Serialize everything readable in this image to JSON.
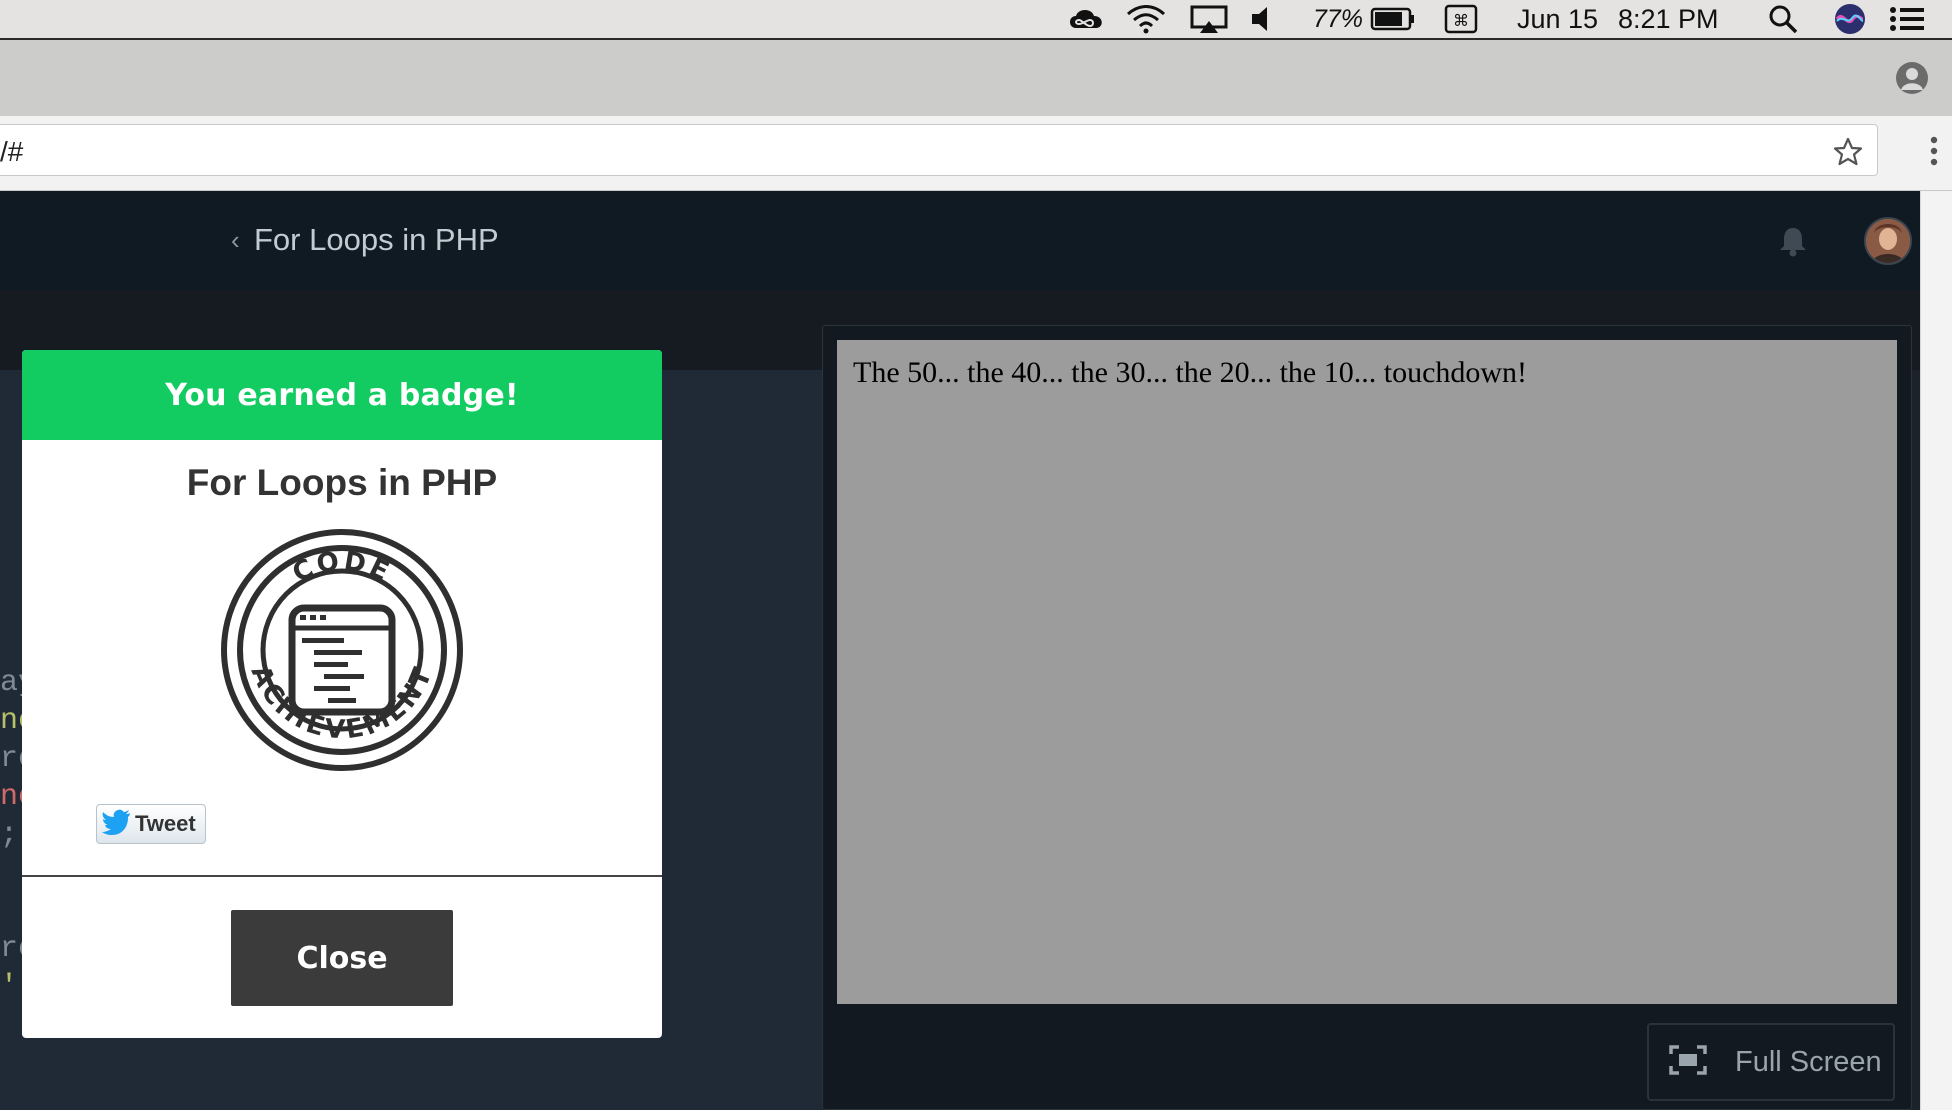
{
  "menubar": {
    "battery_percent": "77%",
    "date": "Jun 15",
    "time": "8:21 PM"
  },
  "browser": {
    "url_fragment": "/#"
  },
  "header": {
    "back_chevron": "‹",
    "title": "For Loops in PHP"
  },
  "editor": {
    "fragments": [
      "ay",
      "ne",
      "re",
      "ne",
      ";|",
      "re",
      "';"
    ]
  },
  "preview": {
    "output": "The 50... the 40... the 30... the 20... the 10... touchdown!",
    "fullscreen_label": "Full Screen"
  },
  "modal": {
    "header": "You earned a badge!",
    "badge_title": "For Loops in PHP",
    "badge_top_text": "CODE",
    "badge_bottom_text": "ACHIEVEMENT",
    "tweet_label": "Tweet",
    "close_label": "Close"
  },
  "colors": {
    "badge_green": "#12cc62",
    "header_bg": "#0f1a23",
    "close_btn": "#3b3b3b"
  }
}
